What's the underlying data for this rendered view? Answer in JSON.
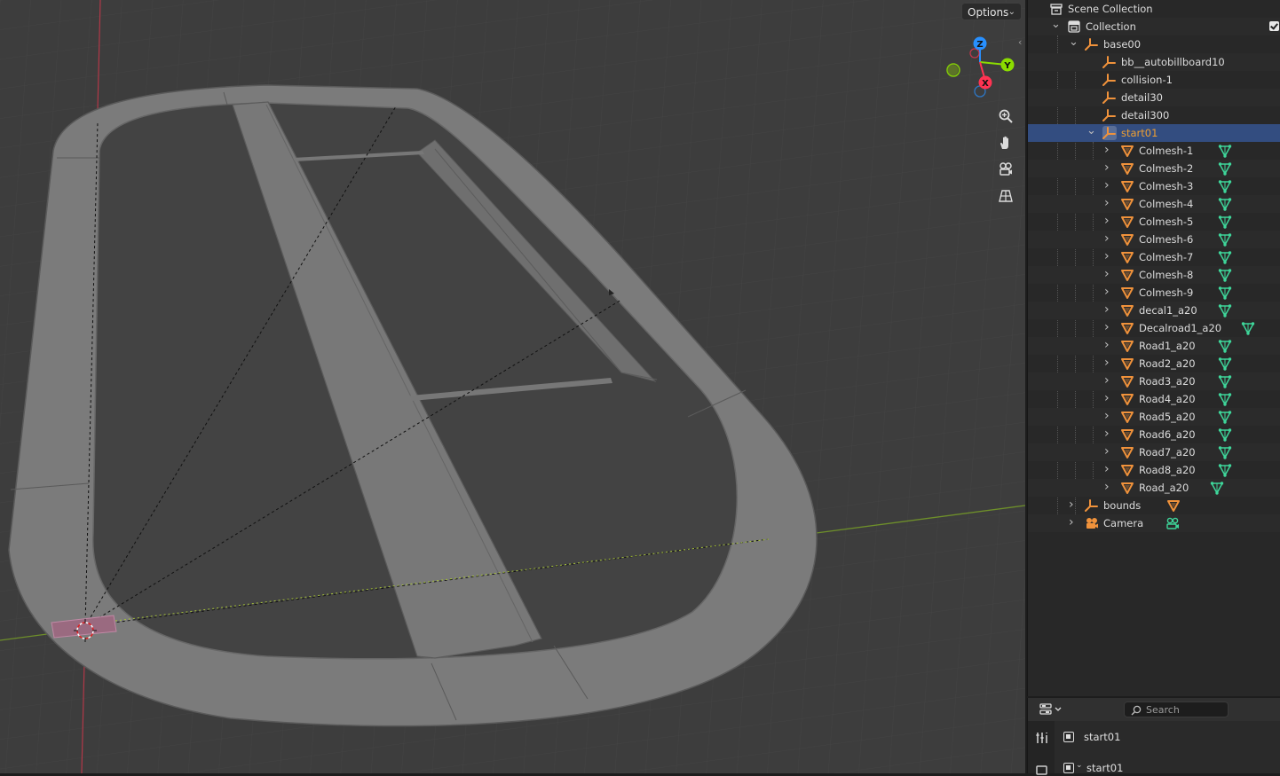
{
  "viewport": {
    "options_label": "Options",
    "gizmo": {
      "z_label": "Z",
      "y_label": "Y",
      "x_label": "X"
    },
    "nav_buttons": [
      "zoom-icon",
      "hand-pan-icon",
      "camera-view-icon",
      "grid-ortho-icon"
    ]
  },
  "outliner": {
    "rows": [
      {
        "label": "Scene Collection",
        "icon": "scene-collection-icon"
      },
      {
        "label": "Collection",
        "icon": "collection-icon",
        "expanded": true,
        "checkbox": true
      },
      {
        "label": "base00",
        "icon": "empty-icon",
        "expanded": true
      },
      {
        "label": "bb__autobillboard10",
        "icon": "empty-icon"
      },
      {
        "label": "collision-1",
        "icon": "empty-icon"
      },
      {
        "label": "detail30",
        "icon": "empty-icon"
      },
      {
        "label": "detail300",
        "icon": "empty-icon"
      },
      {
        "label": "start01",
        "icon": "empty-icon",
        "expanded": true,
        "selected": true
      },
      {
        "label": "Colmesh-1",
        "icon": "mesh-object-icon",
        "modifier": "mesh-data-icon"
      },
      {
        "label": "Colmesh-2",
        "icon": "mesh-object-icon",
        "modifier": "mesh-data-icon"
      },
      {
        "label": "Colmesh-3",
        "icon": "mesh-object-icon",
        "modifier": "mesh-data-icon"
      },
      {
        "label": "Colmesh-4",
        "icon": "mesh-object-icon",
        "modifier": "mesh-data-icon"
      },
      {
        "label": "Colmesh-5",
        "icon": "mesh-object-icon",
        "modifier": "mesh-data-icon"
      },
      {
        "label": "Colmesh-6",
        "icon": "mesh-object-icon",
        "modifier": "mesh-data-icon"
      },
      {
        "label": "Colmesh-7",
        "icon": "mesh-object-icon",
        "modifier": "mesh-data-icon"
      },
      {
        "label": "Colmesh-8",
        "icon": "mesh-object-icon",
        "modifier": "mesh-data-icon"
      },
      {
        "label": "Colmesh-9",
        "icon": "mesh-object-icon",
        "modifier": "mesh-data-icon"
      },
      {
        "label": "decal1_a20",
        "icon": "mesh-object-icon",
        "modifier": "mesh-data-icon"
      },
      {
        "label": "Decalroad1_a20",
        "icon": "mesh-object-icon",
        "modifier": "mesh-data-icon"
      },
      {
        "label": "Road1_a20",
        "icon": "mesh-object-icon",
        "modifier": "mesh-data-icon"
      },
      {
        "label": "Road2_a20",
        "icon": "mesh-object-icon",
        "modifier": "mesh-data-icon"
      },
      {
        "label": "Road3_a20",
        "icon": "mesh-object-icon",
        "modifier": "mesh-data-icon"
      },
      {
        "label": "Road4_a20",
        "icon": "mesh-object-icon",
        "modifier": "mesh-data-icon"
      },
      {
        "label": "Road5_a20",
        "icon": "mesh-object-icon",
        "modifier": "mesh-data-icon"
      },
      {
        "label": "Road6_a20",
        "icon": "mesh-object-icon",
        "modifier": "mesh-data-icon"
      },
      {
        "label": "Road7_a20",
        "icon": "mesh-object-icon",
        "modifier": "mesh-data-icon"
      },
      {
        "label": "Road8_a20",
        "icon": "mesh-object-icon",
        "modifier": "mesh-data-icon"
      },
      {
        "label": "Road_a20",
        "icon": "mesh-object-icon",
        "modifier": "mesh-data-icon"
      },
      {
        "label": "bounds",
        "icon": "empty-icon",
        "modifier": "mesh-object-icon"
      },
      {
        "label": "Camera",
        "icon": "camera-object-icon",
        "modifier": "camera-data-icon"
      }
    ]
  },
  "properties": {
    "search_placeholder": "Search",
    "object_name": "start01",
    "data_name": "start01"
  },
  "colors": {
    "accent_selected": "#334d80",
    "active_label": "#f0a032",
    "axis_x": "#ff3352",
    "axis_y": "#8bdc00",
    "axis_z": "#2890ff",
    "mesh_icon": "#f0923b",
    "mesh_data_icon": "#3ed69a"
  }
}
